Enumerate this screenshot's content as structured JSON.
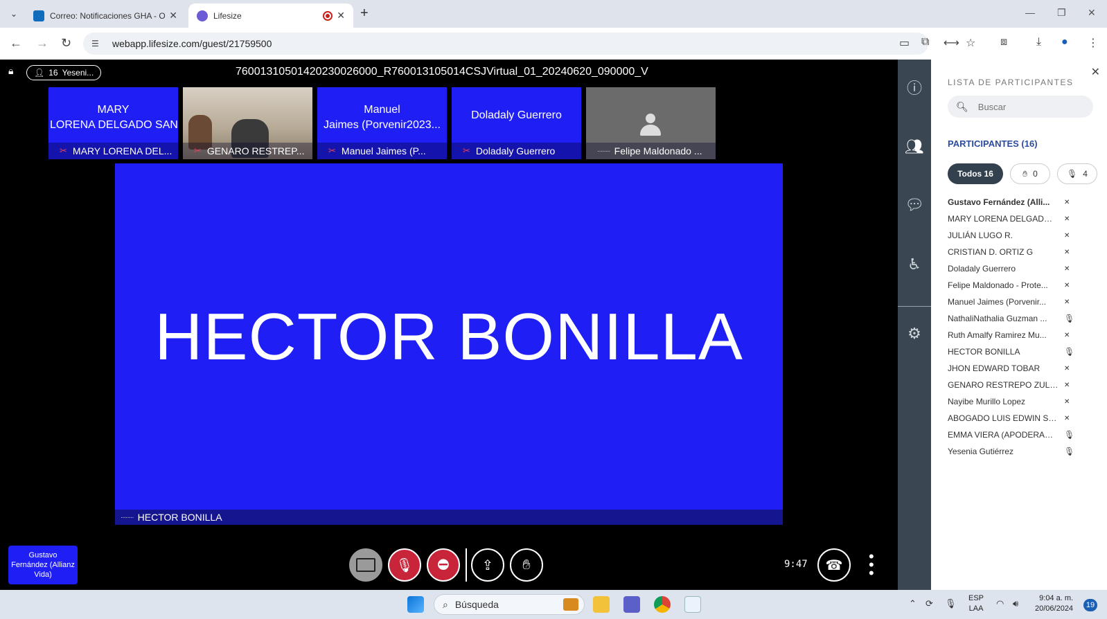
{
  "browser": {
    "tabs": [
      {
        "title": "Correo: Notificaciones GHA - O",
        "favicon_color": "#0f6cbd"
      },
      {
        "title": "Lifesize",
        "favicon_color": "#6b5bd6"
      }
    ],
    "url": "webapp.lifesize.com/guest/21759500"
  },
  "meeting": {
    "participant_badge": {
      "count": "16",
      "name": "Yeseni..."
    },
    "title": "76001310501420230026000_R760013105014CSJVirtual_01_20240620_090000_V",
    "strip": [
      {
        "big": "MARY\nLORENA DELGADO SAN...",
        "big_line1": "MARY",
        "big_line2": "LORENA DELGADO SAN...",
        "foot": "MARY LORENA DEL..."
      },
      {
        "foot": "GENARO RESTREP..."
      },
      {
        "big_line1": "Manuel",
        "big_line2": "Jaimes (Porvenir2023...",
        "foot": "Manuel Jaimes (P..."
      },
      {
        "big_line1": "Doladaly Guerrero",
        "foot": "Doladaly Guerrero"
      },
      {
        "foot": "Felipe Maldonado ..."
      }
    ],
    "active_speaker": {
      "name": "HECTOR BONILLA",
      "foot": "HECTOR BONILLA"
    },
    "self_view": "Gustavo Fernández (Allianz Vida)",
    "timer": "9:47"
  },
  "panel": {
    "heading": "LISTA DE PARTICIPANTES",
    "search_placeholder": "Buscar",
    "count_label": "PARTICIPANTES (16)",
    "filters": {
      "all": "Todos 16",
      "hands": "0",
      "mics": "4"
    },
    "participants": [
      {
        "name": "Gustavo Fernández (Alli...",
        "muted": true
      },
      {
        "name": "MARY LORENA DELGADO S...",
        "muted": true
      },
      {
        "name": "JULIÁN LUGO R.",
        "muted": true
      },
      {
        "name": "CRISTIAN D. ORTIZ G",
        "muted": true
      },
      {
        "name": "Doladaly Guerrero",
        "muted": true
      },
      {
        "name": "Felipe Maldonado - Prote...",
        "muted": true
      },
      {
        "name": "Manuel Jaimes (Porvenir...",
        "muted": true
      },
      {
        "name": "NathaliNathalia Guzman ...",
        "muted": false
      },
      {
        "name": "Ruth Amalfy Ramirez Mu...",
        "muted": true
      },
      {
        "name": "HECTOR BONILLA",
        "muted": false
      },
      {
        "name": "JHON EDWARD TOBAR",
        "muted": true
      },
      {
        "name": "GENARO RESTREPO ZULUA...",
        "muted": true
      },
      {
        "name": "Nayibe Murillo Lopez",
        "muted": true
      },
      {
        "name": "ABOGADO LUIS EDWIN SA...",
        "muted": true
      },
      {
        "name": "EMMA VIERA (APODERADA...",
        "muted": false
      },
      {
        "name": "Yesenia Gutiérrez",
        "muted": false
      }
    ]
  },
  "taskbar": {
    "search_label": "Búsqueda",
    "lang_line1": "ESP",
    "lang_line2": "LAA",
    "time": "9:04 a. m.",
    "date": "20/06/2024",
    "notifications": "19"
  },
  "colors": {
    "tile_blue": "#1f1ff5",
    "rail": "#3a4652",
    "muted_red": "#c8243a"
  }
}
